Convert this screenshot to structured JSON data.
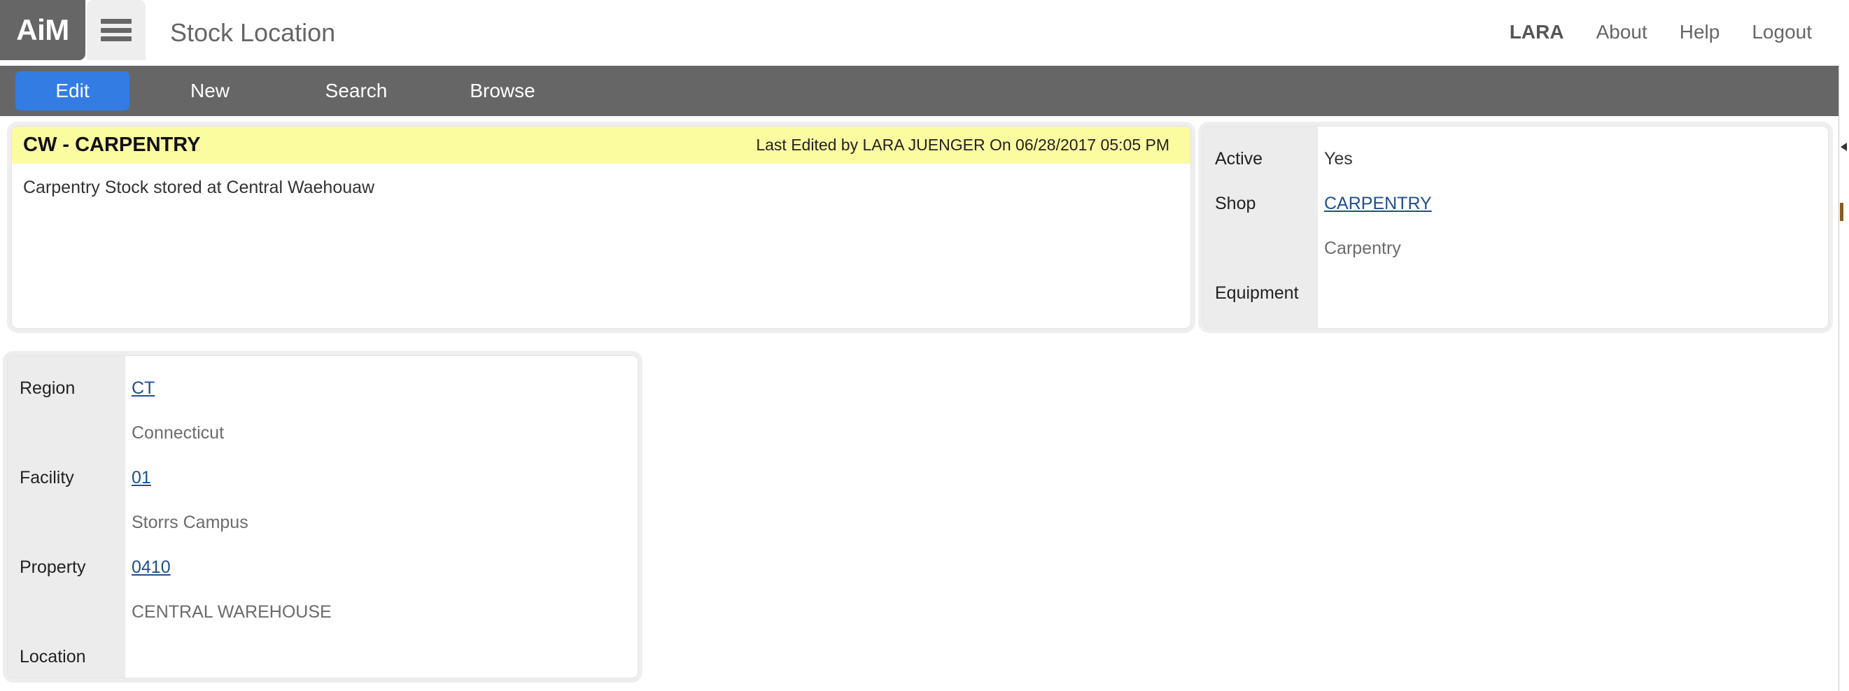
{
  "app": {
    "brand": "AiM",
    "menu_icon": "hamburger-menu-icon",
    "page_title": "Stock Location"
  },
  "topnav": {
    "user": "LARA",
    "about": "About",
    "help": "Help",
    "logout": "Logout"
  },
  "tabs": [
    {
      "label": "Edit",
      "active": true
    },
    {
      "label": "New",
      "active": false
    },
    {
      "label": "Search",
      "active": false
    },
    {
      "label": "Browse",
      "active": false
    }
  ],
  "record": {
    "title": "CW - CARPENTRY",
    "last_edited": "Last Edited by LARA JUENGER On 06/28/2017 05:05 PM",
    "description": "Carpentry Stock stored at Central Waehouaw"
  },
  "attributes": {
    "rows": [
      {
        "label": "Active",
        "value": "Yes",
        "link": false,
        "sub": null
      },
      {
        "label": "Shop",
        "value": "CARPENTRY",
        "link": true,
        "sub": "Carpentry"
      },
      {
        "label": "Equipment",
        "value": "",
        "link": false,
        "sub": null
      }
    ]
  },
  "location": {
    "rows": [
      {
        "label": "Region",
        "value": "CT",
        "link": true,
        "sub": "Connecticut"
      },
      {
        "label": "Facility",
        "value": "01",
        "link": true,
        "sub": "Storrs Campus"
      },
      {
        "label": "Property",
        "value": "0410",
        "link": true,
        "sub": "CENTRAL WAREHOUSE"
      },
      {
        "label": "Location",
        "value": "",
        "link": false,
        "sub": null
      }
    ]
  },
  "colors": {
    "brand_bar": "#666666",
    "accent_tab": "#337ce4",
    "record_header": "#fbfba0",
    "link": "#1f4f8f",
    "label_column": "#ececec"
  }
}
